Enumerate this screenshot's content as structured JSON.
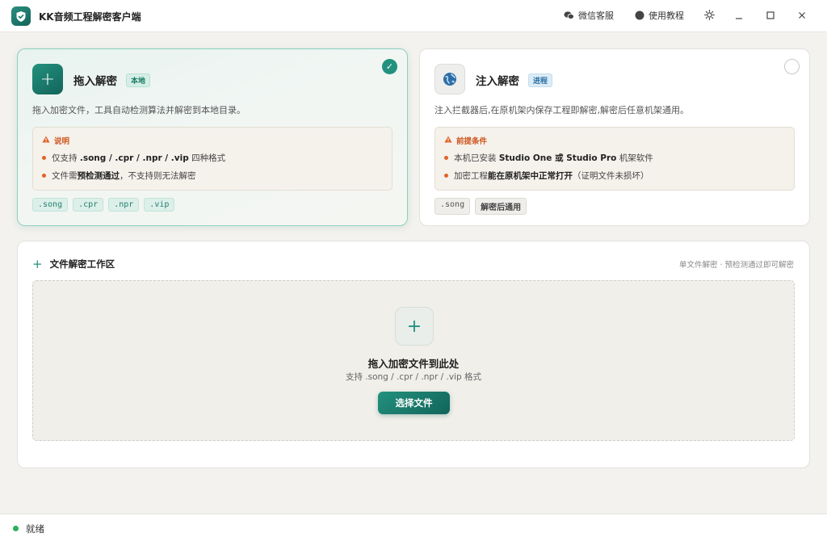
{
  "app": {
    "title": "KK音频工程解密客户端",
    "wechat_support": "微信客服",
    "tutorial": "使用教程"
  },
  "colors": {
    "accent": "#23917e",
    "warning": "#e0622a",
    "ready": "#28b05a"
  },
  "mode_local": {
    "title": "拖入解密",
    "tag": "本地",
    "description": "拖入加密文件，工具自动检测算法并解密到本地目录。",
    "note_title": "说明",
    "note_line1_pre": "仅支持 ",
    "note_line1_bold": ".song / .cpr / .npr / .vip",
    "note_line1_post": " 四种格式",
    "note_line2_pre": "文件需",
    "note_line2_bold": "预检测通过",
    "note_line2_post": "，不支持则无法解密",
    "chips": [
      ".song",
      ".cpr",
      ".npr",
      ".vip"
    ],
    "selected": true
  },
  "mode_inject": {
    "title": "注入解密",
    "tag": "进程",
    "description": "注入拦截器后,在原机架内保存工程即解密,解密后任意机架通用。",
    "note_title": "前提条件",
    "note_line1_pre": "本机已安装 ",
    "note_line1_bold": "Studio One",
    "note_line1_mid": " 或 ",
    "note_line1_bold2": "Studio Pro",
    "note_line1_post": " 机架软件",
    "note_line2_pre": "加密工程",
    "note_line2_bold": "能在原机架中正常打开",
    "note_line2_post": "（证明文件未损坏）",
    "chips": [
      ".song",
      "解密后通用"
    ],
    "selected": false
  },
  "workspace": {
    "title": "文件解密工作区",
    "hint": "单文件解密 · 预检测通过即可解密",
    "drop_title": "拖入加密文件到此处",
    "drop_sub": "支持 .song / .cpr / .npr / .vip 格式",
    "select_button": "选择文件"
  },
  "status": {
    "text": "就绪"
  }
}
